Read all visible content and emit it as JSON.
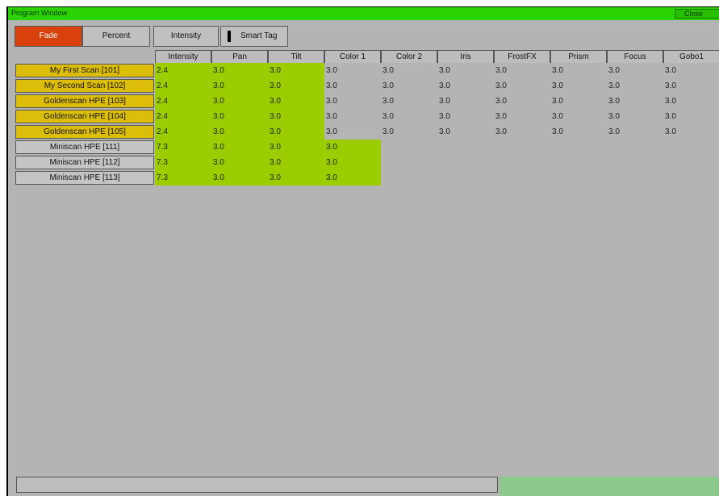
{
  "window": {
    "title": "Program Window",
    "close_label": "Close"
  },
  "toolbar": {
    "fade_label": "Fade",
    "percent_label": "Percent",
    "intensity_label": "Intensity",
    "smarttag_label": "Smart Tag"
  },
  "columns": [
    "Intensity",
    "Pan",
    "Tilt",
    "Color 1",
    "Color 2",
    "Iris",
    "FrostFX",
    "Prism",
    "Focus",
    "Gobo1"
  ],
  "rows": [
    {
      "label": "My First Scan [101]",
      "cells": [
        "2.4",
        "3.0",
        "3.0",
        "3.0",
        "3.0",
        "3.0",
        "3.0",
        "3.0",
        "3.0",
        "3.0"
      ]
    },
    {
      "label": "My Second Scan [102]",
      "cells": [
        "2.4",
        "3.0",
        "3.0",
        "3.0",
        "3.0",
        "3.0",
        "3.0",
        "3.0",
        "3.0",
        "3.0"
      ]
    },
    {
      "label": "Goldenscan HPE [103]",
      "cells": [
        "2.4",
        "3.0",
        "3.0",
        "3.0",
        "3.0",
        "3.0",
        "3.0",
        "3.0",
        "3.0",
        "3.0"
      ]
    },
    {
      "label": "Goldenscan HPE [104]",
      "cells": [
        "2.4",
        "3.0",
        "3.0",
        "3.0",
        "3.0",
        "3.0",
        "3.0",
        "3.0",
        "3.0",
        "3.0"
      ]
    },
    {
      "label": "Goldenscan HPE [105]",
      "cells": [
        "2.4",
        "3.0",
        "3.0",
        "3.0",
        "3.0",
        "3.0",
        "3.0",
        "3.0",
        "3.0",
        "3.0"
      ]
    },
    {
      "label": "Miniscan HPE [111]",
      "cells": [
        "7.3",
        "3.0",
        "3.0",
        "3.0"
      ]
    },
    {
      "label": "Miniscan HPE [112]",
      "cells": [
        "7.3",
        "3.0",
        "3.0",
        "3.0"
      ]
    },
    {
      "label": "Miniscan HPE [113]",
      "cells": [
        "7.3",
        "3.0",
        "3.0",
        "3.0"
      ]
    }
  ],
  "colors": {
    "titlebar": "#2bd400",
    "fade_active": "#d8400c",
    "fixture_label_yellow": "#dcbe0a",
    "fixture_label_gray": "#c4c4c4",
    "cell_active_green": "#9bcd00",
    "background": "#b4b4b4"
  }
}
